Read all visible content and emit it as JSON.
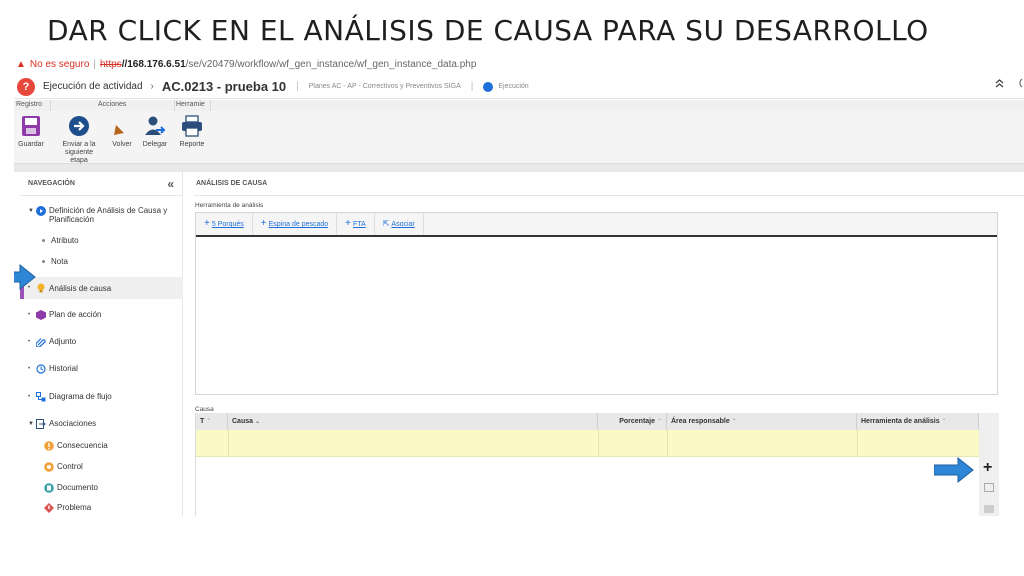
{
  "slide": {
    "title": "DAR CLICK EN EL ANÁLISIS DE CAUSA PARA SU DESARROLLO"
  },
  "address_bar": {
    "insecure_label": "No es seguro",
    "scheme": "https",
    "host": "//168.176.6.51",
    "path": "/se/v20479/workflow/wf_gen_instance/wf_gen_instance_data.php"
  },
  "header": {
    "logo_glyph": "?",
    "title": "Ejecución de actividad",
    "separator": "›",
    "code": "AC.0213 - prueba 10",
    "pipe": "|",
    "subtitle": "Planes AC - AP - Correctivos y Preventivos SIGA",
    "status": "Ejecución"
  },
  "ribbon": {
    "tabs": {
      "registro": "Registro",
      "acciones": "Acciones",
      "herramientas": "Herramie"
    },
    "buttons": {
      "guardar": "Guardar",
      "enviar_line1": "Enviar a la",
      "enviar_line2": "siguiente etapa",
      "volver": "Volver",
      "delegar": "Delegar",
      "reporte": "Reporte"
    }
  },
  "sidebar": {
    "header": "NAVEGACIÓN",
    "collapse": "«",
    "items": {
      "definicion_line1": "Definición de Análisis de Causa y",
      "definicion_line2": "Planificación",
      "atributo": "Atributo",
      "nota": "Nota",
      "analisis": "Análisis de causa",
      "plan": "Plan de acción",
      "adjunto": "Adjunto",
      "historial": "Historial",
      "diagrama": "Diagrama de flujo",
      "asociaciones": "Asociaciones",
      "consecuencia": "Consecuencia",
      "control": "Control",
      "documento": "Documento",
      "problema": "Problema"
    }
  },
  "main": {
    "header": "ANÁLISIS DE CAUSA",
    "tool_label": "Herramienta de análisis",
    "tool_tabs": {
      "porques": "5 Porqués",
      "espina": "Espina de pescado",
      "fta": "FTA",
      "asociar": "Asociar"
    },
    "causa_label": "Causa",
    "columns": {
      "t": "T",
      "causa": "Causa",
      "porcentaje": "Porcentaje",
      "area": "Área responsable",
      "herramienta": "Herramienta de análisis"
    },
    "add_glyph": "+"
  },
  "colors": {
    "accent_blue": "#1e6fd9",
    "active_purple": "#9b4fb8",
    "highlight_row": "#fbfac6",
    "arrow_blue": "#2e86d6"
  }
}
